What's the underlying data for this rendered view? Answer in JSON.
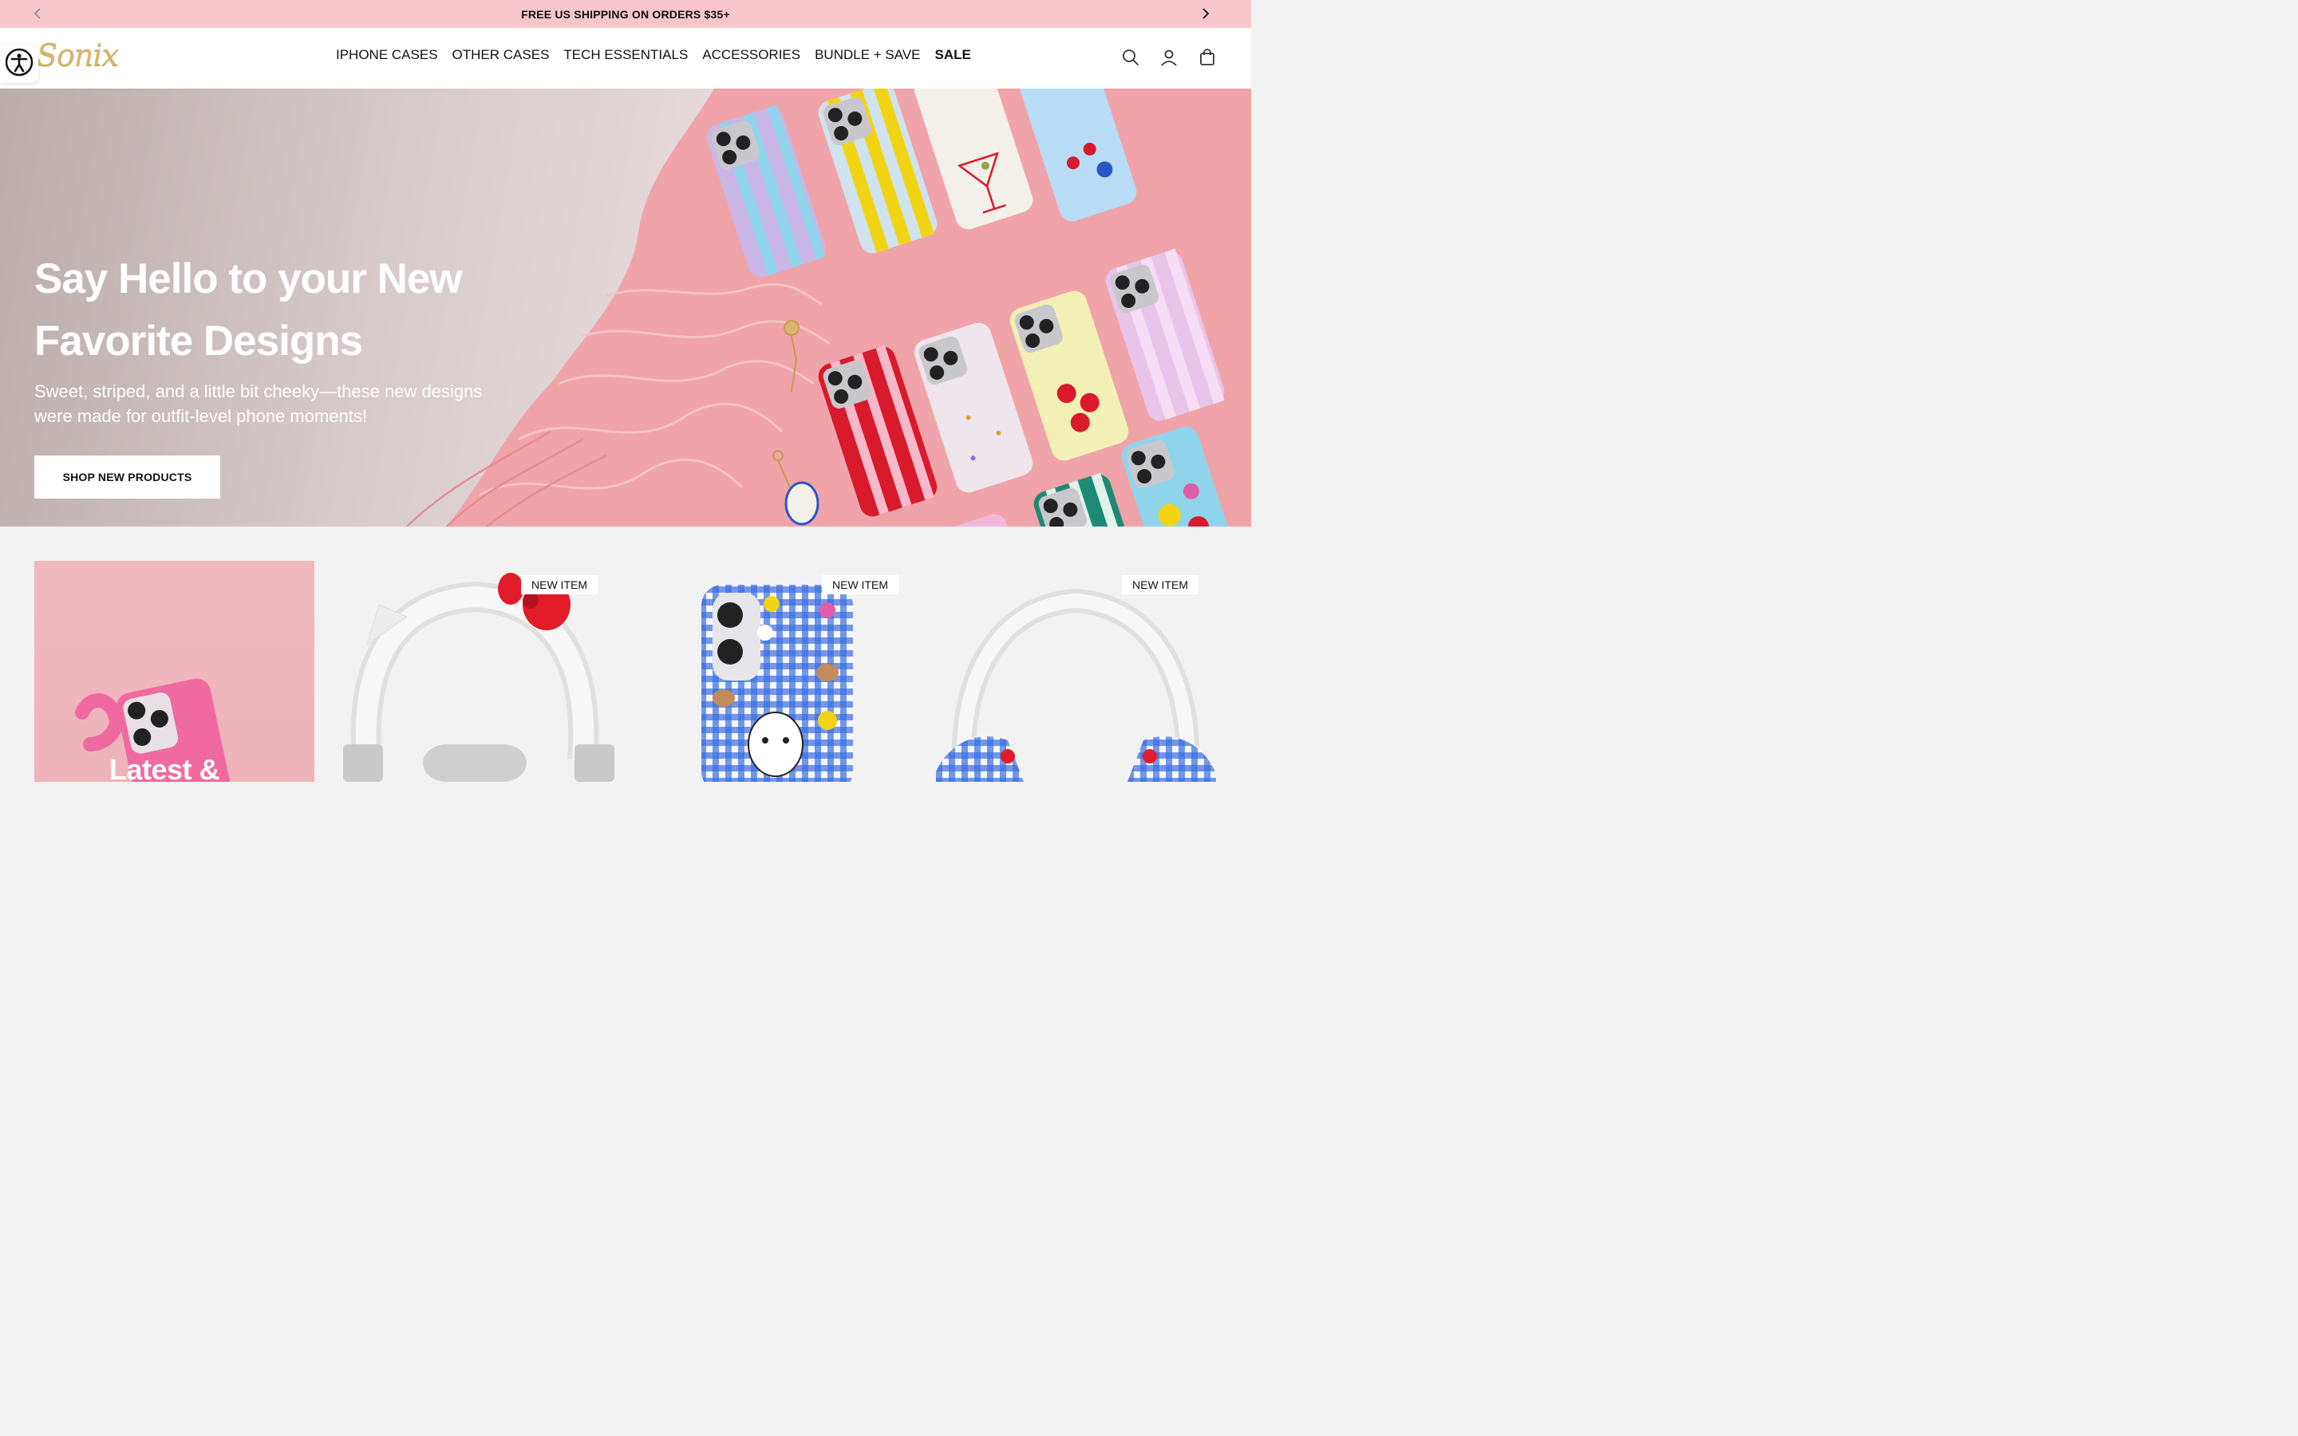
{
  "announcement": {
    "text": "FREE US SHIPPING ON ORDERS $35+"
  },
  "header": {
    "logo": "Sonix",
    "nav": [
      {
        "label": "IPHONE CASES"
      },
      {
        "label": "OTHER CASES"
      },
      {
        "label": "TECH ESSENTIALS"
      },
      {
        "label": "ACCESSORIES"
      },
      {
        "label": "BUNDLE + SAVE"
      },
      {
        "label": "SALE"
      }
    ],
    "icons": [
      "accessibility-icon",
      "search-icon",
      "account-icon",
      "cart-icon"
    ]
  },
  "hero": {
    "title": "Say Hello to your New Favorite Designs",
    "subtitle": "Sweet, striped, and a little bit cheeky—these new designs were made for outfit-level phone moments!",
    "cta": "SHOP NEW PRODUCTS"
  },
  "products": {
    "promo_title": "Latest &",
    "items": [
      {
        "badge": "NEW ITEM"
      },
      {
        "badge": "NEW ITEM"
      },
      {
        "badge": "NEW ITEM"
      }
    ]
  },
  "colors": {
    "announcement_bg": "#f7c6cd",
    "accent_pink": "#f0a9ac",
    "stripe_red": "#d9192c",
    "stripe_green": "#1f8a74",
    "stripe_yellow": "#f1d515"
  }
}
